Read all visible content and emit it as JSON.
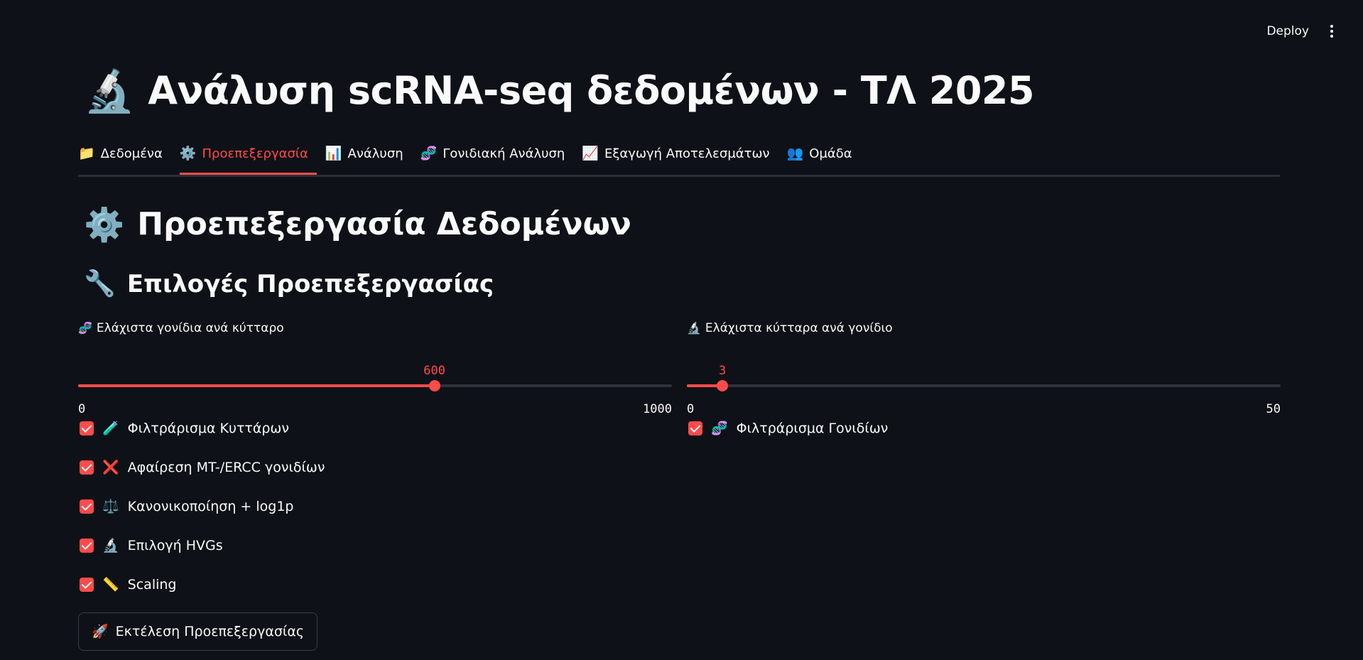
{
  "topbar": {
    "deploy_label": "Deploy"
  },
  "title": {
    "emoji": "🔬",
    "text": "Ανάλυση scRNA-seq δεδομένων - ΤΛ 2025"
  },
  "tabs": [
    {
      "emoji": "📁",
      "label": "Δεδομένα",
      "active": false
    },
    {
      "emoji": "⚙️",
      "label": "Προεπεξεργασία",
      "active": true
    },
    {
      "emoji": "📊",
      "label": "Ανάλυση",
      "active": false
    },
    {
      "emoji": "🧬",
      "label": "Γονιδιακή Ανάλυση",
      "active": false
    },
    {
      "emoji": "📈",
      "label": "Εξαγωγή Αποτελεσμάτων",
      "active": false
    },
    {
      "emoji": "👥",
      "label": "Ομάδα",
      "active": false
    }
  ],
  "section": {
    "emoji": "⚙️",
    "text": "Προεπεξεργασία Δεδομένων"
  },
  "subsection": {
    "emoji": "🔧",
    "text": "Επιλογές Προεπεξεργασίας"
  },
  "sliders": {
    "min_genes": {
      "emoji": "🧬",
      "label": "Ελάχιστα γονίδια ανά κύτταρο",
      "value": "600",
      "min": "0",
      "max": "1000",
      "fraction": 0.6
    },
    "min_cells": {
      "emoji": "🔬",
      "label": "Ελάχιστα κύτταρα ανά γονίδιο",
      "value": "3",
      "min": "0",
      "max": "50",
      "fraction": 0.06
    }
  },
  "checkboxes_left": [
    {
      "emoji": "🧪",
      "label": "Φιλτράρισμα Κυττάρων",
      "checked": true
    },
    {
      "emoji": "❌",
      "label": "Αφαίρεση MT-/ERCC γονιδίων",
      "checked": true
    },
    {
      "emoji": "⚖️",
      "label": "Κανονικοποίηση + log1p",
      "checked": true
    },
    {
      "emoji": "🔬",
      "label": "Επιλογή HVGs",
      "checked": true
    },
    {
      "emoji": "📏",
      "label": "Scaling",
      "checked": true
    }
  ],
  "checkboxes_right": [
    {
      "emoji": "🧬",
      "label": "Φιλτράρισμα Γονιδίων",
      "checked": true
    }
  ],
  "run_button": {
    "emoji": "🚀",
    "label": "Εκτέλεση Προεπεξεργασίας"
  },
  "colors": {
    "accent": "#ff4b4b",
    "background": "#0e1117",
    "text": "#fafafa"
  }
}
